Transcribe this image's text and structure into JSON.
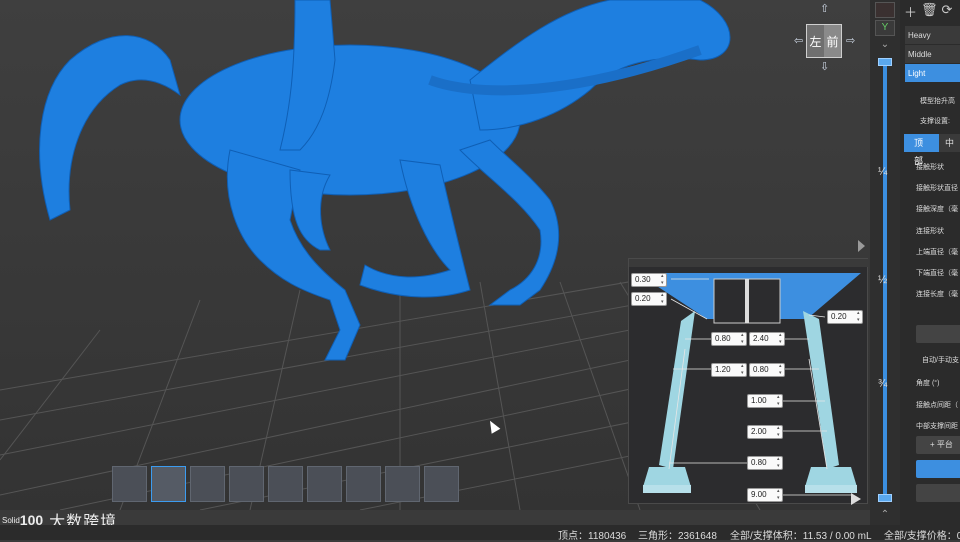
{
  "viewport": {
    "cube_left": "左",
    "cube_front": "前",
    "orientation_label": "Y"
  },
  "diagram": {
    "values": {
      "v1": "0.30",
      "v2": "0.20",
      "v3": "0.20",
      "v4": "0.80",
      "v5": "2.40",
      "v6": "1.20",
      "v7": "0.80",
      "v8": "1.00",
      "v9": "2.00",
      "v10": "0.80",
      "v11": "9.00"
    }
  },
  "slider": {
    "marks": [
      "¼",
      "½",
      "¾"
    ]
  },
  "panel": {
    "presets": [
      "Heavy",
      "Middle",
      "Light"
    ],
    "selected_preset": "Light",
    "model_lift": "模型抬升高",
    "support_settings": "支撑设置:",
    "tab_top": "顶部",
    "tab_middle": "中",
    "rows": [
      "接触形状",
      "接触形状直径",
      "接触深度（毫",
      "连接形状",
      "上端直径（毫",
      "下端直径（毫",
      "连接长度（毫"
    ],
    "auto_manual": "自动/手动支",
    "angle": "角度 (°)",
    "contact_spacing": "接触点间距（",
    "middle_spacing": "中部支撑间距",
    "add_platform": "+ 平台"
  },
  "brand": {
    "small": "Solid",
    "logo": "100",
    "name": "大数跨境"
  },
  "status": {
    "vertices": "顶点：1180436",
    "triangles": "三角形：2361648",
    "volume": "全部/支撑体积：11.53 / 0.00 mL",
    "price": "全部/支撑价格：0"
  },
  "colors": {
    "model": "#1e7fe0",
    "accent": "#3d8fe0",
    "support": "#9fd6e2"
  }
}
